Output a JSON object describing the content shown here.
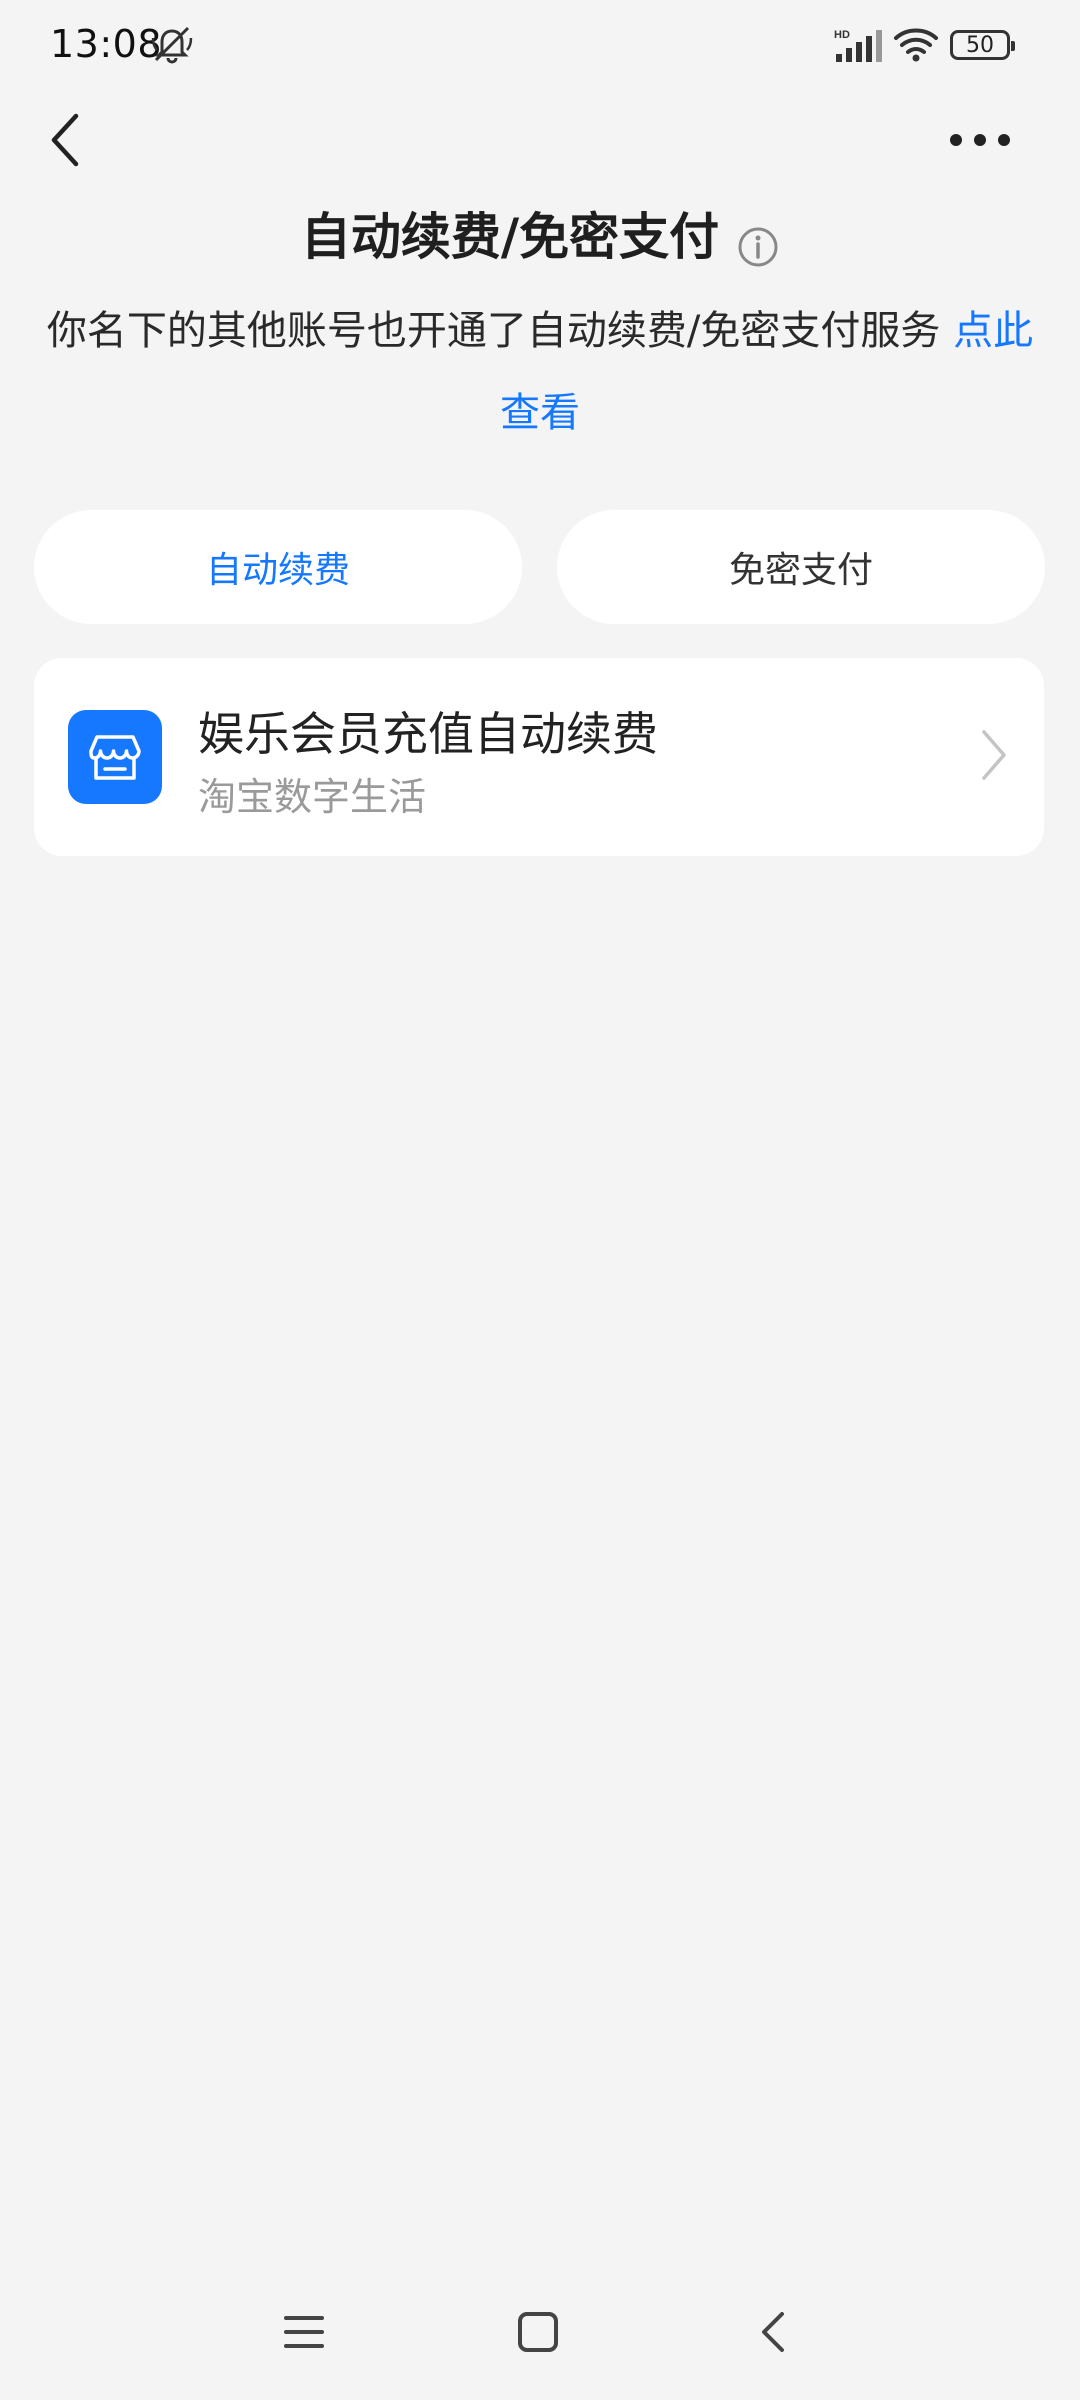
{
  "status_bar": {
    "time": "13:08",
    "battery": "50",
    "icons": [
      "mute-icon",
      "signal-icon",
      "wifi-icon",
      "battery-icon"
    ]
  },
  "header": {
    "title": "自动续费/免密支付",
    "back_icon": "chevron-left-icon",
    "more_icon": "more-dots-icon",
    "info_icon": "info-icon"
  },
  "notice": {
    "text": "你名下的其他账号也开通了自动续费/免密支付服务 ",
    "link_text": "点此查看"
  },
  "tabs": [
    {
      "label": "自动续费",
      "active": true
    },
    {
      "label": "免密支付",
      "active": false
    }
  ],
  "services": [
    {
      "title": "娱乐会员充值自动续费",
      "subtitle": "淘宝数字生活",
      "icon": "store-icon"
    }
  ],
  "colors": {
    "accent": "#1677ff",
    "background": "#f4f4f4",
    "card": "#ffffff",
    "secondary_text": "#9a9a9a"
  }
}
